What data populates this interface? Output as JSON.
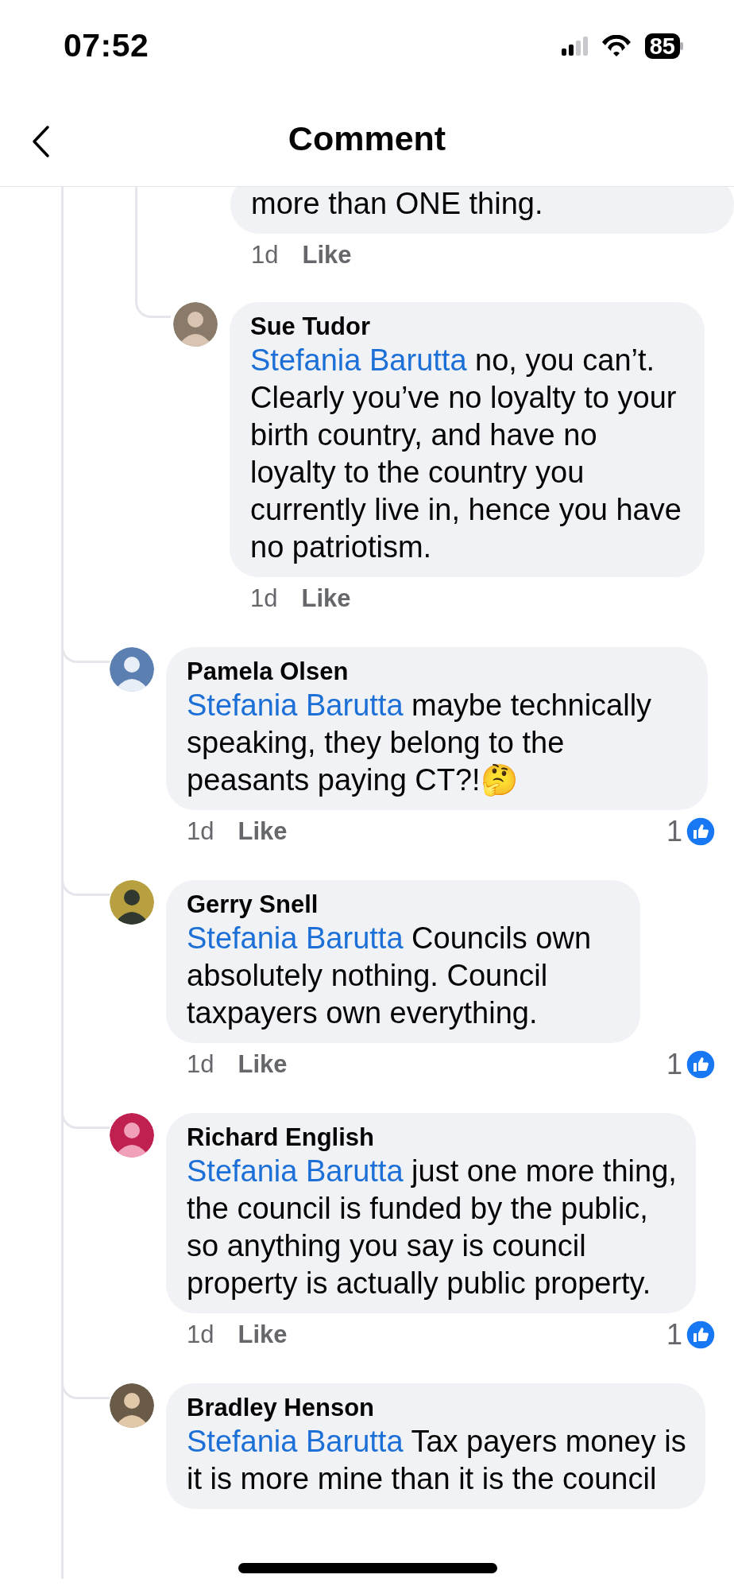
{
  "status_bar": {
    "time": "07:52",
    "battery": "85"
  },
  "header": {
    "title": "Comment"
  },
  "replies": [
    {
      "text": "more than ONE thing.",
      "time": "1d",
      "like": "Like"
    },
    {
      "author": "Sue Tudor",
      "mention": "Stefania Barutta",
      "text": "no, you can’t. Clearly you’ve no loyalty to your birth country, and have no loyalty to the country you currently live in, hence you have no patriotism.",
      "time": "1d",
      "like": "Like"
    }
  ],
  "comments": [
    {
      "author": "Pamela Olsen",
      "mention": "Stefania Barutta",
      "text": "maybe technically speaking, they belong to the peasants paying CT?!🤔",
      "time": "1d",
      "like": "Like",
      "reactions": "1"
    },
    {
      "author": "Gerry Snell",
      "mention": "Stefania Barutta",
      "text": "Councils own absolutely nothing. Council taxpayers own everything.",
      "time": "1d",
      "like": "Like",
      "reactions": "1"
    },
    {
      "author": "Richard English",
      "mention": "Stefania Barutta",
      "text": "just one more thing, the council is funded by the public, so anything you say is council property is actually public property.",
      "time": "1d",
      "like": "Like",
      "reactions": "1"
    },
    {
      "author": "Bradley Henson",
      "mention": "Stefania Barutta",
      "text": "Tax payers money is it is more mine than it is the council"
    }
  ]
}
